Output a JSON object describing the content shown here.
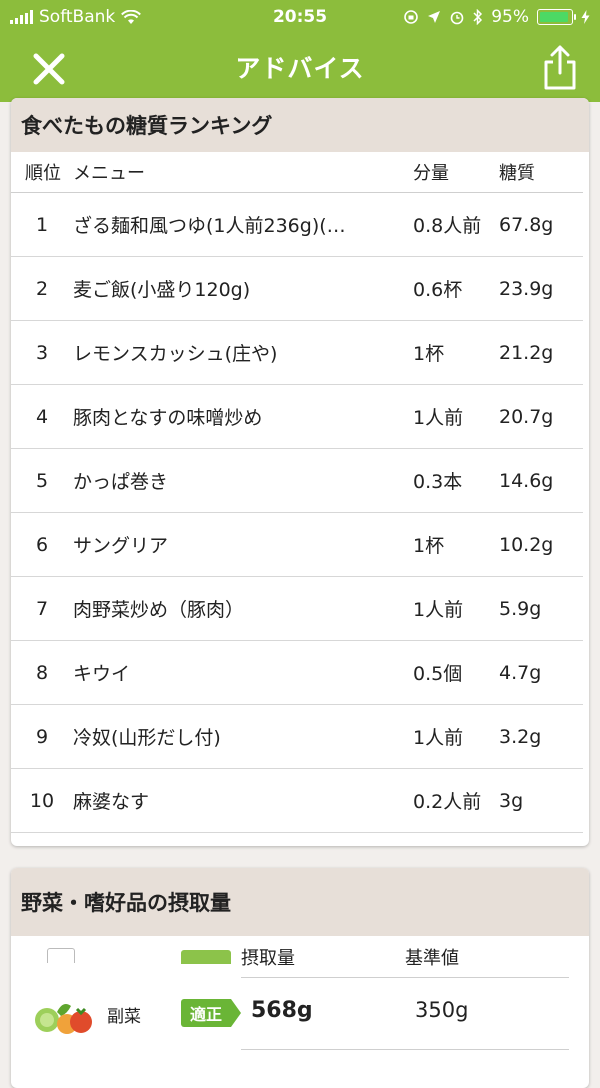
{
  "status_bar": {
    "carrier": "SoftBank",
    "time": "20:55",
    "battery_percent": "95%",
    "battery_level": 0.95
  },
  "navbar": {
    "title": "アドバイス",
    "close_icon": "close-icon",
    "share_icon": "share-icon"
  },
  "ranking": {
    "title": "食べたもの糖質ランキング",
    "headers": {
      "rank": "順位",
      "menu": "メニュー",
      "amount": "分量",
      "carbs": "糖質"
    },
    "rows": [
      {
        "rank": "1",
        "menu": "ざる麺和風つゆ(1人前236g)(…",
        "amount": "0.8人前",
        "carbs": "67.8g"
      },
      {
        "rank": "2",
        "menu": "麦ご飯(小盛り120g)",
        "amount": "0.6杯",
        "carbs": "23.9g"
      },
      {
        "rank": "3",
        "menu": "レモンスカッシュ(庄や)",
        "amount": "1杯",
        "carbs": "21.2g"
      },
      {
        "rank": "4",
        "menu": "豚肉となすの味噌炒め",
        "amount": "1人前",
        "carbs": "20.7g"
      },
      {
        "rank": "5",
        "menu": "かっぱ巻き",
        "amount": "0.3本",
        "carbs": "14.6g"
      },
      {
        "rank": "6",
        "menu": "サングリア",
        "amount": "1杯",
        "carbs": "10.2g"
      },
      {
        "rank": "7",
        "menu": "肉野菜炒め（豚肉）",
        "amount": "1人前",
        "carbs": "5.9g"
      },
      {
        "rank": "8",
        "menu": "キウイ",
        "amount": "0.5個",
        "carbs": "4.7g"
      },
      {
        "rank": "9",
        "menu": "冷奴(山形だし付)",
        "amount": "1人前",
        "carbs": "3.2g"
      },
      {
        "rank": "10",
        "menu": "麻婆なす",
        "amount": "0.2人前",
        "carbs": "3g"
      }
    ]
  },
  "intake": {
    "title": "野菜・嗜好品の摂取量",
    "headers": {
      "amount": "摂取量",
      "standard": "基準値"
    },
    "rows": [
      {
        "label": "副菜",
        "status": "適正",
        "amount": "568g",
        "standard": "350g",
        "icon": "vegetables-icon"
      }
    ]
  },
  "colors": {
    "header_green": "#8cbd3c",
    "tag_green": "#6ab536",
    "card_head": "#e7dfd8",
    "background": "#f2efec"
  }
}
